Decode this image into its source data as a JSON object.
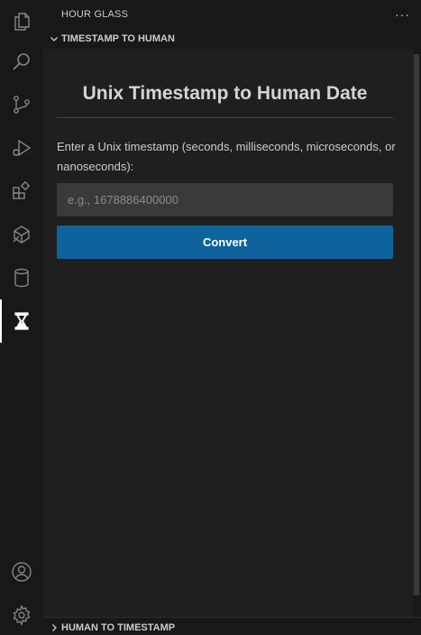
{
  "activity_bar": {
    "items": [
      {
        "icon": "files-icon"
      },
      {
        "icon": "search-icon"
      },
      {
        "icon": "source-control-icon"
      },
      {
        "icon": "run-debug-icon"
      },
      {
        "icon": "extensions-icon"
      },
      {
        "icon": "remote-explorer-icon"
      },
      {
        "icon": "database-icon"
      },
      {
        "icon": "hourglass-icon",
        "active": true
      }
    ],
    "bottom": [
      {
        "icon": "account-icon"
      },
      {
        "icon": "gear-icon"
      }
    ]
  },
  "sidebar": {
    "title": "HOUR GLASS",
    "more_label": "···"
  },
  "sections": {
    "top": {
      "label": "TIMESTAMP TO HUMAN",
      "expanded": true
    },
    "bottom": {
      "label": "HUMAN TO TIMESTAMP",
      "expanded": false
    }
  },
  "panel": {
    "title": "Unix Timestamp to Human Date",
    "instruction": "Enter a Unix timestamp (seconds, milliseconds, microseconds, or nanoseconds):",
    "input": {
      "placeholder": "e.g., 1678886400000",
      "value": ""
    },
    "convert_label": "Convert"
  },
  "colors": {
    "accent": "#0e639c",
    "background": "#1f1f1f",
    "sidebar": "#181818"
  }
}
